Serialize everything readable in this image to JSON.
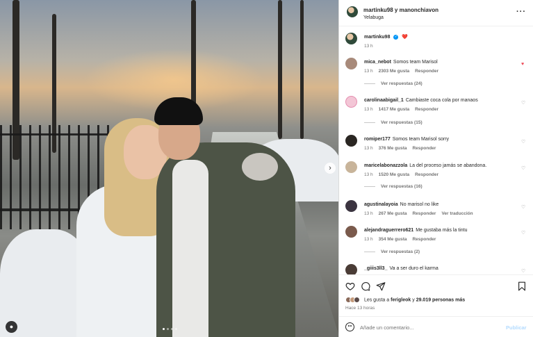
{
  "post": {
    "author_header": "martinku98 y manonchiavon",
    "location": "Yelabuga",
    "more_icon": "more-dots-icon",
    "caption_user": "martinku98",
    "caption_text": "❤️",
    "caption_time": "13 h",
    "carousel": {
      "total_slides": 4,
      "current_slide": 1
    }
  },
  "comments": [
    {
      "user": "mica_nebot",
      "text": "Somos team Marisol",
      "time": "13 h",
      "likes": "2303 Me gusta",
      "action": "Responder",
      "liked": true,
      "replies": "Ver respuestas (24)"
    },
    {
      "user": "carolinaabigail_1",
      "text": "Cambiaste coca cola por manaos",
      "time": "13 h",
      "likes": "1417 Me gusta",
      "action": "Responder",
      "liked": false,
      "replies": "Ver respuestas (15)"
    },
    {
      "user": "romiper177",
      "text": "Somos team Marisol sorry",
      "time": "13 h",
      "likes": "376 Me gusta",
      "action": "Responder",
      "liked": false,
      "replies": ""
    },
    {
      "user": "maricelabonazzola",
      "text": "La del proceso jamás se abandona.",
      "time": "13 h",
      "likes": "1520 Me gusta",
      "action": "Responder",
      "liked": false,
      "replies": "Ver respuestas (16)"
    },
    {
      "user": "agustinalayoia",
      "text": "No marisol no like",
      "time": "13 h",
      "likes": "267 Me gusta",
      "action": "Responder",
      "extra": "Ver traducción",
      "liked": false,
      "replies": ""
    },
    {
      "user": "alejandraguerrero621",
      "text": "Me gustaba más la tintu",
      "time": "13 h",
      "likes": "354 Me gusta",
      "action": "Responder",
      "liked": false,
      "replies": "Ver respuestas (2)"
    },
    {
      "user": "_giiis3ll3_",
      "text": "Va a ser duro el karma",
      "time": "",
      "likes": "",
      "action": "",
      "liked": false,
      "replies": ""
    }
  ],
  "actions": {
    "like_icon": "heart-icon",
    "comment_icon": "comment-icon",
    "share_icon": "send-icon",
    "save_icon": "bookmark-icon",
    "likes_prefix": "Les gusta a",
    "likes_user": "ferigleok",
    "likes_mid": "y",
    "likes_count": "29.019 personas más",
    "time_ago": "Hace 13 horas"
  },
  "add_comment": {
    "placeholder": "Añade un comentario...",
    "publish_label": "Publicar"
  },
  "colors": {
    "accent": "#0095f6",
    "liked": "#ed4956",
    "muted": "#737373",
    "publish_disabled": "#b3dbff"
  }
}
